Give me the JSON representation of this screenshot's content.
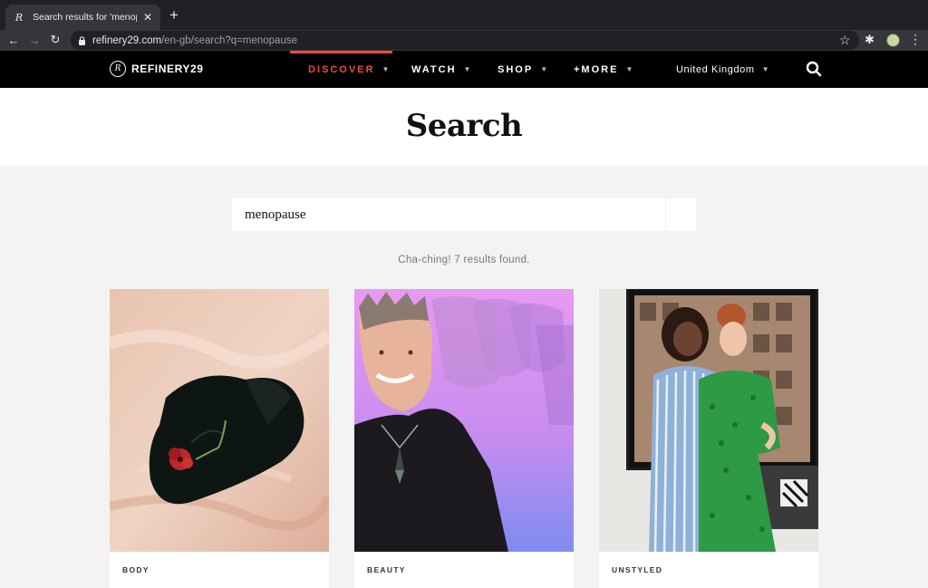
{
  "browser": {
    "tab_title": "Search results for 'menopause'",
    "tab_favicon": "refinery29-favicon",
    "url_host": "refinery29.com",
    "url_path": "/en-gb/search?q=menopause"
  },
  "nav": {
    "logo_text": "REFINERY29",
    "items": [
      {
        "label": "DISCOVER",
        "active": true
      },
      {
        "label": "WATCH",
        "active": false
      },
      {
        "label": "SHOP",
        "active": false
      },
      {
        "label": "+MORE",
        "active": false
      }
    ],
    "region": "United Kingdom",
    "accent_color": "#ee4b3b"
  },
  "page": {
    "title": "Search",
    "search_value": "menopause",
    "result_text": "Cha-ching! 7 results found."
  },
  "results": [
    {
      "category": "BODY",
      "image": "black-underwear-with-red-flower"
    },
    {
      "category": "BEAUTY",
      "image": "smiling-person-purple-gradient-repeat"
    },
    {
      "category": "UNSTYLED",
      "image": "two-women-posing-in-office"
    }
  ]
}
